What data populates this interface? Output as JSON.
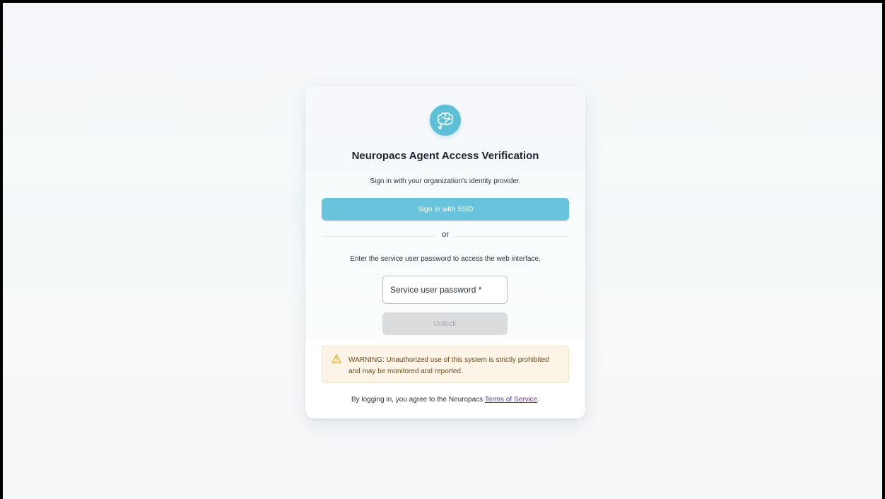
{
  "card": {
    "logo_icon": "brain-circuit-icon",
    "title": "Neuropacs Agent Access Verification",
    "subtitle": "Sign in with your organization's identity provider.",
    "sso_button_label": "Sign in with SSO",
    "divider_text": "or",
    "instruction": "Enter the service user password to access the web interface.",
    "password_placeholder": "Service user password *",
    "unlock_button_label": "Unlock",
    "warning": {
      "icon": "warning-triangle-icon",
      "text": "WARNING: Unauthorized use of this system is strictly prohibited and may be monitored and reported."
    },
    "footer": {
      "prefix": "By logging in, you agree to the Neuropacs ",
      "link_text": "Terms of Service",
      "suffix": "."
    }
  },
  "colors": {
    "accent": "#68c4dc",
    "logo_bg": "#5cc0d6",
    "warning_bg": "#fcf4e6",
    "warning_text": "#6c4a15",
    "warning_icon": "#e8a317",
    "link": "#5a3b95",
    "disabled_button": "#dadcde"
  }
}
